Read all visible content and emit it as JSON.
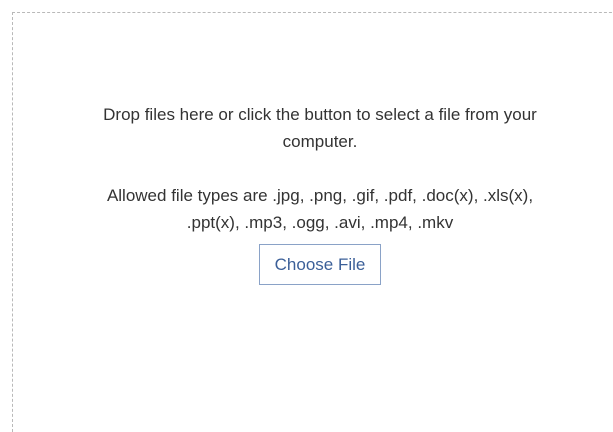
{
  "dropzone": {
    "instruction_line1": "Drop files here or click the button to select a file from your",
    "instruction_line2": "computer.",
    "allowed_line1": "Allowed file types are .jpg, .png, .gif, .pdf, .doc(x), .xls(x),",
    "allowed_line2": ".ppt(x), .mp3, .ogg, .avi, .mp4, .mkv",
    "button_label": "Choose File"
  },
  "colors": {
    "text": "#333333",
    "button_border": "#8aa2c7",
    "button_text": "#3b5f98",
    "dashed_border": "#b9b9b9"
  }
}
